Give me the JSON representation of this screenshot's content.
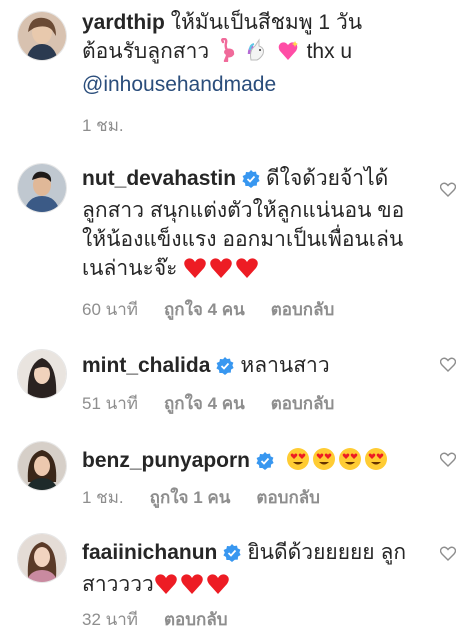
{
  "comments": [
    {
      "user": "yardthip",
      "text_1": "ให้มันเป็นสีชมพู 1 วัน",
      "text_2": "ต้อนรับลูกสาว",
      "text_3": "thx u",
      "mention": "@inhousehandmade",
      "time": "1 ชม.",
      "avatar_color": "#c9a07a"
    },
    {
      "user": "nut_devahastin",
      "text_1": "ดีใจด้วยจ้าได้",
      "text_2": "ลูกสาว สนุกแต่งตัวให้ลูกแน่นอน ขอ",
      "text_3": "ให้น้องแข็งแรง ออกมาเป็นเพื่อนเล่น",
      "text_4": "เนล่านะจ๊ะ",
      "time": "60 นาที",
      "likes": "ถูกใจ 4 คน",
      "reply": "ตอบกลับ",
      "avatar_color": "#4a6a8a"
    },
    {
      "user": "mint_chalida",
      "text_1": "หลานสาว",
      "time": "51 นาที",
      "likes": "ถูกใจ 4 คน",
      "reply": "ตอบกลับ",
      "avatar_color": "#3a3030"
    },
    {
      "user": "benz_punyaporn",
      "time": "1 ชม.",
      "likes": "ถูกใจ 1 คน",
      "reply": "ตอบกลับ",
      "avatar_color": "#8a6a5a"
    },
    {
      "user": "faaiinichanun",
      "text_1": "ยินดีด้วยยยยย ลูก",
      "text_2": "สาวววว",
      "time": "32 นาที",
      "reply": "ตอบกลับ",
      "avatar_color": "#b89a8a"
    }
  ],
  "colors": {
    "verified": "#3897f0",
    "heart_red": "#ed1c24",
    "meta_gray": "#8e8e8e"
  }
}
